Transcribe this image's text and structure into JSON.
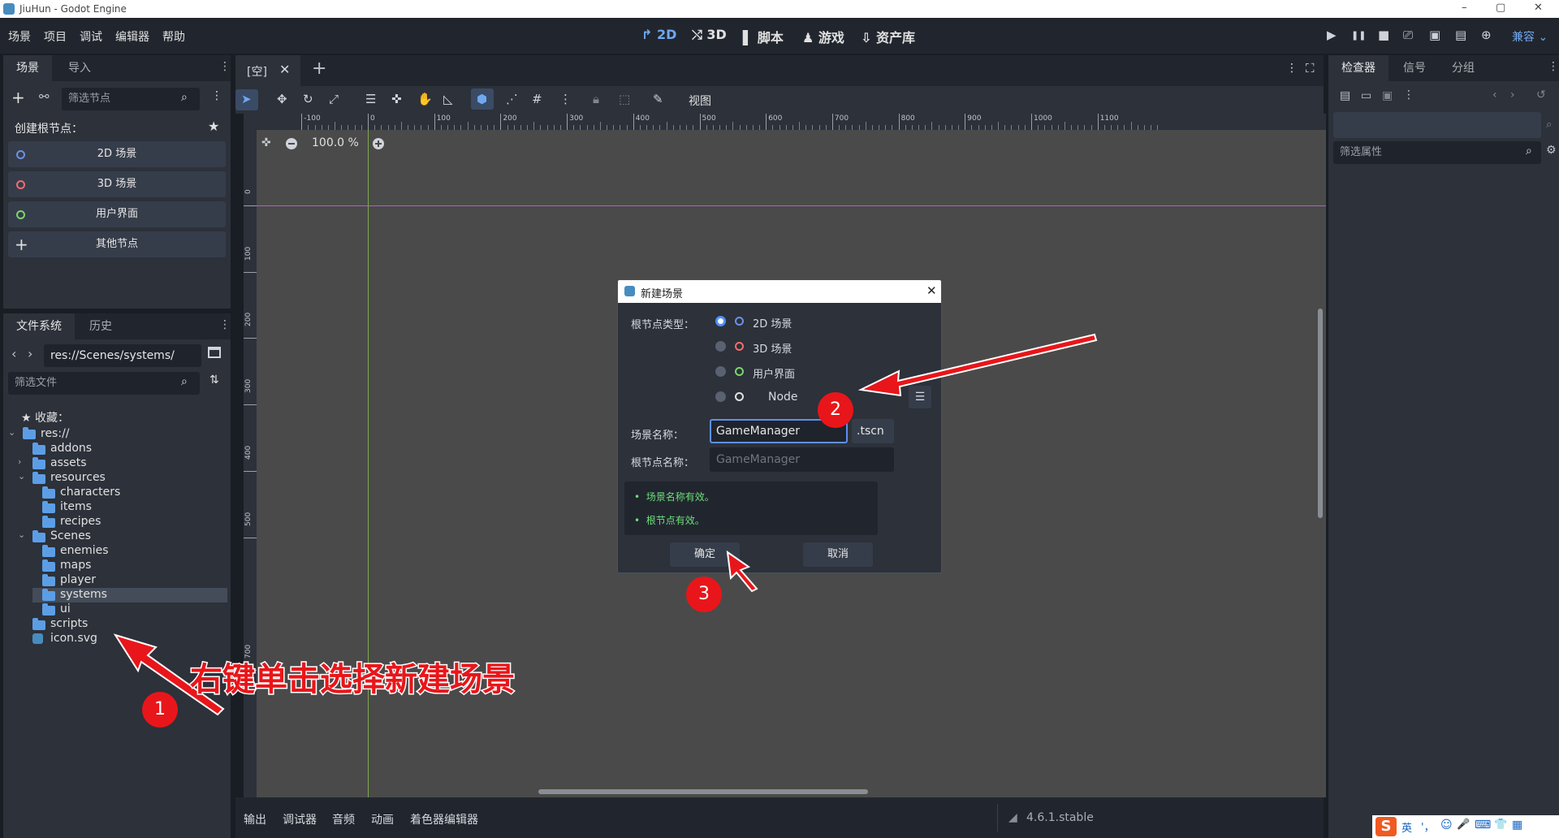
{
  "window": {
    "title": "JiuHun - Godot Engine",
    "min": "–",
    "max": "▢",
    "close": "✕"
  },
  "menu": [
    "场景",
    "项目",
    "调试",
    "编辑器",
    "帮助"
  ],
  "workspaces": [
    {
      "label": "2D",
      "icon": "↱"
    },
    {
      "label": "3D",
      "icon": "⤭"
    },
    {
      "label": "脚本",
      "icon": "▌"
    },
    {
      "label": "游戏",
      "icon": "♟"
    },
    {
      "label": "资产库",
      "icon": "⇩"
    }
  ],
  "play_controls": {
    "play": "▶",
    "pause": "❚❚",
    "stop": "■",
    "renderer": "兼容"
  },
  "scene_dock": {
    "tabs": [
      "场景",
      "导入"
    ],
    "filter_placeholder": "筛选节点",
    "create_root_label": "创建根节点：",
    "root_options": [
      {
        "label": "2D 场景",
        "color": "#6d90e5"
      },
      {
        "label": "3D 场景",
        "color": "#f26c6c"
      },
      {
        "label": "用户界面",
        "color": "#7bd46b"
      },
      {
        "label": "其他节点",
        "color": "#e0e0e0"
      }
    ]
  },
  "fs_dock": {
    "tabs": [
      "文件系统",
      "历史"
    ],
    "path": "res://Scenes/systems/",
    "filter_placeholder": "筛选文件",
    "favorites_label": "收藏：",
    "tree": [
      {
        "label": "res://",
        "depth": 0,
        "kind": "root",
        "arrow": "down"
      },
      {
        "label": "addons",
        "depth": 1,
        "kind": "folder",
        "arrow": ""
      },
      {
        "label": "assets",
        "depth": 1,
        "kind": "folder",
        "arrow": "right"
      },
      {
        "label": "resources",
        "depth": 1,
        "kind": "folder",
        "arrow": "down"
      },
      {
        "label": "characters",
        "depth": 2,
        "kind": "folder",
        "arrow": ""
      },
      {
        "label": "items",
        "depth": 2,
        "kind": "folder",
        "arrow": ""
      },
      {
        "label": "recipes",
        "depth": 2,
        "kind": "folder",
        "arrow": ""
      },
      {
        "label": "Scenes",
        "depth": 1,
        "kind": "folder",
        "arrow": "down"
      },
      {
        "label": "enemies",
        "depth": 2,
        "kind": "folder",
        "arrow": ""
      },
      {
        "label": "maps",
        "depth": 2,
        "kind": "folder",
        "arrow": ""
      },
      {
        "label": "player",
        "depth": 2,
        "kind": "folder",
        "arrow": ""
      },
      {
        "label": "systems",
        "depth": 2,
        "kind": "folder",
        "arrow": "",
        "selected": true
      },
      {
        "label": "ui",
        "depth": 2,
        "kind": "folder",
        "arrow": ""
      },
      {
        "label": "scripts",
        "depth": 1,
        "kind": "folder",
        "arrow": ""
      },
      {
        "label": "icon.svg",
        "depth": 1,
        "kind": "file",
        "arrow": ""
      }
    ]
  },
  "editor": {
    "scene_tab": "[空]",
    "view_menu": "视图",
    "zoom": "100.0 %",
    "ruler_h": [
      "-100",
      "0",
      "100",
      "200",
      "300",
      "400",
      "500",
      "600",
      "700",
      "800",
      "900",
      "1000",
      "1100"
    ],
    "ruler_v": [
      "0",
      "100",
      "200",
      "300",
      "400",
      "500",
      "700"
    ]
  },
  "inspector": {
    "tabs": [
      "检查器",
      "信号",
      "分组"
    ],
    "filter_placeholder": "筛选属性"
  },
  "dialog": {
    "title": "新建场景",
    "root_type_label": "根节点类型：",
    "options": [
      {
        "label": "2D 场景",
        "color": "#6d90e5",
        "selected": true
      },
      {
        "label": "3D 场景",
        "color": "#f26c6c",
        "selected": false
      },
      {
        "label": "用户界面",
        "color": "#7bd46b",
        "selected": false
      },
      {
        "label": "Node",
        "color": "#e0e0e0",
        "selected": false
      }
    ],
    "scene_name_label": "场景名称：",
    "scene_name_value": "GameManager",
    "extension": ".tscn",
    "root_name_label": "根节点名称：",
    "root_name_placeholder": "GameManager",
    "messages": [
      "场景名称有效。",
      "根节点有效。"
    ],
    "ok_label": "确定",
    "cancel_label": "取消"
  },
  "bottom_bar": {
    "tabs": [
      "输出",
      "调试器",
      "音频",
      "动画",
      "着色器编辑器"
    ],
    "version": "4.6.1.stable"
  },
  "annotations": {
    "step1": "1",
    "step2": "2",
    "step3": "3",
    "caption": "右键单击选择新建场景"
  },
  "ime_tray": [
    "S",
    "英",
    "'，",
    "☺",
    "🎤",
    "⌨",
    "👕",
    "▦"
  ]
}
